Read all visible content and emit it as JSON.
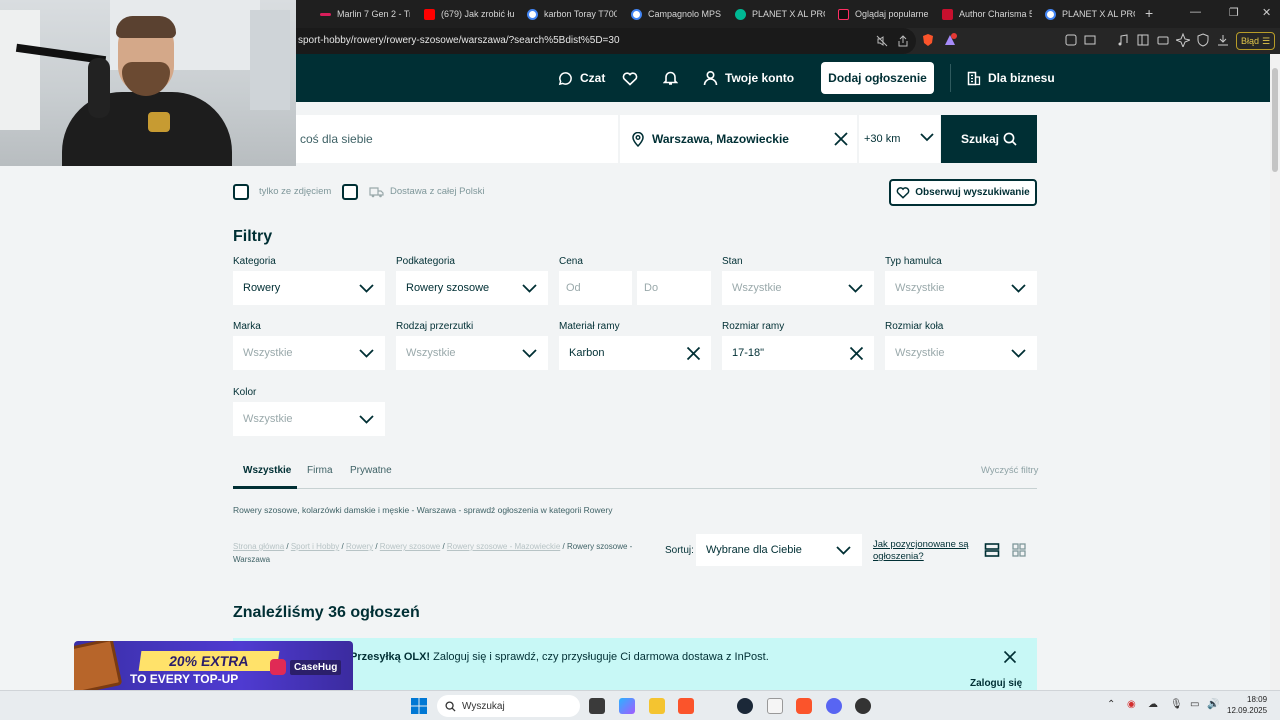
{
  "browser": {
    "tabs": [
      {
        "label": "Marlin 7 Gen 2 - Tre",
        "color": "#d81e5b"
      },
      {
        "label": "(679) Jak zrobić łuk",
        "color": "#ff0000"
      },
      {
        "label": "karbon Toray T700",
        "color": "#4285f4"
      },
      {
        "label": "Campagnolo MPS M",
        "color": "#4285f4"
      },
      {
        "label": "PLANET X AL PRO S",
        "color": "#00b894"
      },
      {
        "label": "Oglądaj popularne",
        "color": "#111111"
      },
      {
        "label": "Author Charisma 55",
        "color": "#c8102e"
      },
      {
        "label": "PLANET X AL PRO C",
        "color": "#4285f4"
      }
    ],
    "url": "sport-hobby/rowery/rowery-szosowe/warszawa/?search%5Bdist%5D=30",
    "error_label": "Błąd"
  },
  "header": {
    "chat": "Czat",
    "account": "Twoje konto",
    "add_listing": "Dodaj ogłoszenie",
    "business": "Dla biznesu"
  },
  "search": {
    "placeholder": "coś dla siebie",
    "location": "Warszawa, Mazowieckie",
    "distance": "+30 km",
    "button": "Szukaj"
  },
  "options": {
    "photo_only": "tylko ze zdjęciem",
    "delivery": "Dostawa z całej Polski",
    "watch": "Obserwuj wyszukiwanie"
  },
  "filters": {
    "title": "Filtry",
    "kategoria": {
      "label": "Kategoria",
      "value": "Rowery"
    },
    "podkategoria": {
      "label": "Podkategoria",
      "value": "Rowery szosowe"
    },
    "cena": {
      "label": "Cena",
      "from": "Od",
      "to": "Do"
    },
    "stan": {
      "label": "Stan",
      "value": "Wszystkie"
    },
    "hamulec": {
      "label": "Typ hamulca",
      "value": "Wszystkie"
    },
    "marka": {
      "label": "Marka",
      "value": "Wszystkie"
    },
    "przerzutki": {
      "label": "Rodzaj przerzutki",
      "value": "Wszystkie"
    },
    "material": {
      "label": "Materiał ramy",
      "value": "Karbon"
    },
    "rozmiar_ramy": {
      "label": "Rozmiar ramy",
      "value": "17-18\""
    },
    "rozmiar_kola": {
      "label": "Rozmiar koła",
      "value": "Wszystkie"
    },
    "kolor": {
      "label": "Kolor",
      "value": "Wszystkie"
    }
  },
  "seller_tabs": {
    "all": "Wszystkie",
    "company": "Firma",
    "private": "Prywatne",
    "clear": "Wyczyść filtry"
  },
  "seo_text": "Rowery szosowe, kolarzówki damskie i męskie - Warszawa - sprawdź ogłoszenia w kategorii Rowery",
  "breadcrumbs": {
    "items": [
      "Strona główna",
      "Sport i Hobby",
      "Rowery",
      "Rowery szosowe",
      "Rowery szosowe - Mazowieckie"
    ],
    "current": "Rowery szosowe - Warszawa"
  },
  "sort": {
    "label": "Sortuj:",
    "value": "Wybrane dla Ciebie",
    "how_link": "Jak pozycjonowane są ogłoszenia?"
  },
  "results": {
    "found": "Znaleźliśmy 36 ogłoszeń"
  },
  "banner": {
    "bold": "Przesyłką OLX!",
    "text": " Zaloguj się i sprawdź, czy przysługuje Ci darmowa dostawa z InPost.",
    "login": "Zaloguj się"
  },
  "ad": {
    "line1": "20% EXTRA",
    "line2": "TO EVERY TOP-UP",
    "brand": "CaseHug"
  },
  "taskbar": {
    "search": "Wyszukaj",
    "time": "18:09",
    "date": "12.09.2025"
  }
}
